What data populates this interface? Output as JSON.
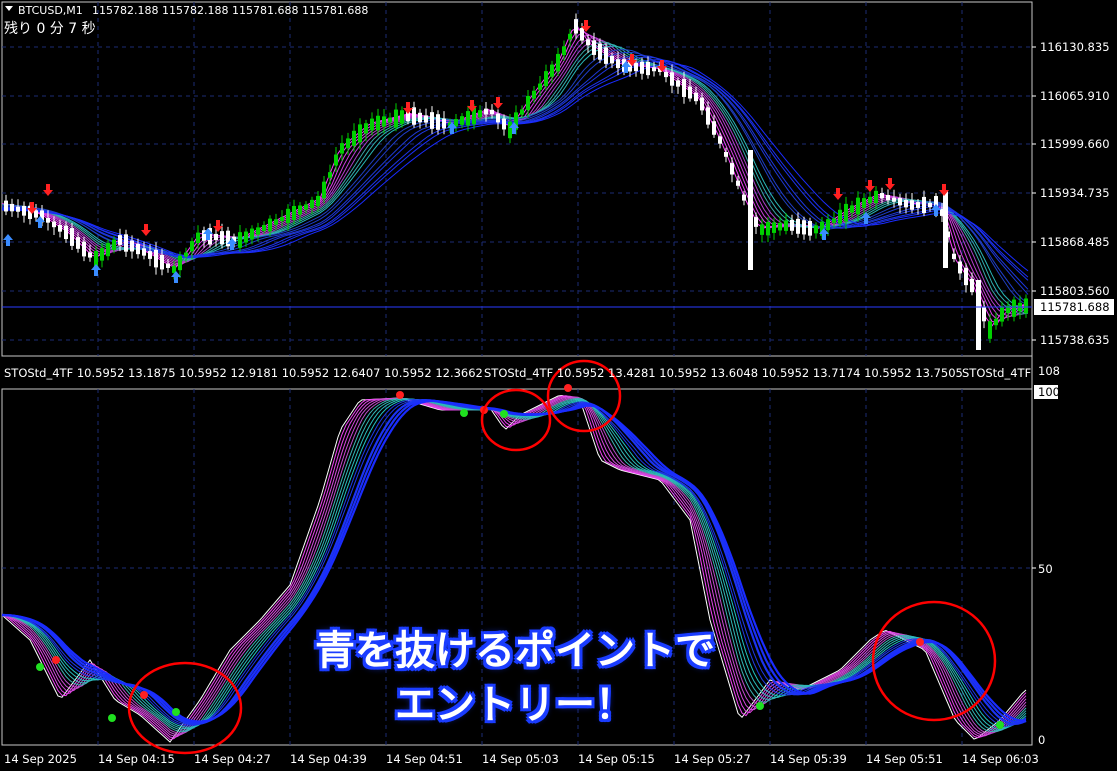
{
  "window": {
    "symbol_label": "BTCUSD,M1",
    "ohlc": "115782.188 115782.188 115781.688 115781.688",
    "countdown": "残り 0 分 7 秒"
  },
  "price_axis": {
    "ticks": [
      "116130.835",
      "116065.910",
      "115999.660",
      "115934.735",
      "115868.485",
      "115803.560",
      "115738.635"
    ],
    "current_price": "115781.688"
  },
  "indicator": {
    "header": "STOStd_4TF 10.5952 13.1875 10.5952 12.9181 10.5952 12.6407 10.5952 12.3662",
    "header_2": "STOStd_4TF 10.5952 13.4281 10.5952 13.6048 10.5952 13.7174 10.5952 13.7505",
    "header_3": "STOStd_4TF",
    "axis_ticks": [
      "108",
      "100",
      "50",
      "0"
    ]
  },
  "time_axis": [
    "14 Sep 2025",
    "14 Sep 04:15",
    "14 Sep 04:27",
    "14 Sep 04:39",
    "14 Sep 04:51",
    "14 Sep 05:03",
    "14 Sep 05:15",
    "14 Sep 05:27",
    "14 Sep 05:39",
    "14 Sep 05:51",
    "14 Sep 06:03"
  ],
  "overlay": {
    "line1": "青を抜けるポイントで",
    "line2": "エントリー！"
  },
  "colors": {
    "background": "#000000",
    "grid": "#1c2b73",
    "bull_candle": "#00d000",
    "bear_candle": "#ffffff",
    "ribbon_slow": "#1a2cff",
    "ribbon_fast": "#ff40ff",
    "ribbon_mid": "#20c0c0",
    "marker_red": "#ff2020",
    "marker_green": "#20e020",
    "circle": "#ff0000"
  },
  "icons": {
    "sell_arrow": "red-down-arrow-icon",
    "buy_arrow": "blue-up-arrow-icon",
    "menu_toggle": "triangle-down-icon"
  }
}
